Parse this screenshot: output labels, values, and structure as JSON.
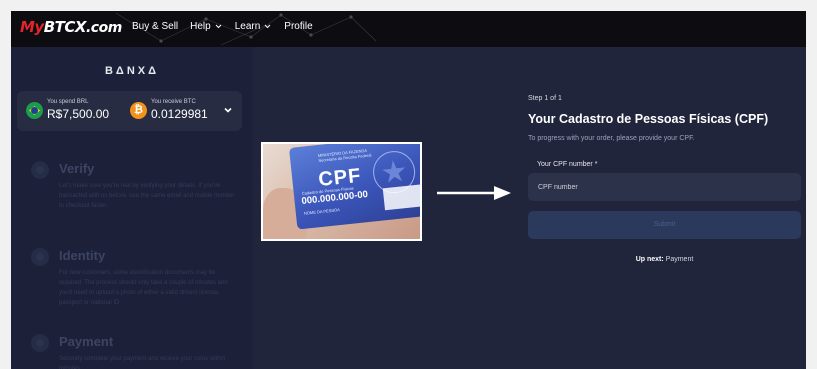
{
  "brand": {
    "my": "My",
    "btc": "BTCX",
    "dotcom": ".com"
  },
  "nav": [
    {
      "label": "Buy & Sell",
      "dropdown": false
    },
    {
      "label": "Help",
      "dropdown": true
    },
    {
      "label": "Learn",
      "dropdown": true
    },
    {
      "label": "Profile",
      "dropdown": false
    }
  ],
  "sidebar": {
    "banxa": "BΔNXΔ",
    "quote": {
      "spend_label": "You spend BRL",
      "spend_value": "R$7,500.00",
      "receive_label": "You receive BTC",
      "receive_value": "0.0129981",
      "btc_symbol": "₿"
    },
    "steps": [
      {
        "title": "Verify",
        "desc": "Let's make sure you're real by verifying your details. If you've transacted with us before, use the same email and mobile number to checkout faster."
      },
      {
        "title": "Identity",
        "desc": "For new customers, some identification documents may be required. The process should only take a couple of minutes and you'll need to upload a photo of either a valid drivers licence, passport or national ID."
      },
      {
        "title": "Payment",
        "desc": "Securely complete your payment and receive your coins within minutes."
      }
    ]
  },
  "form": {
    "step_of": "Step 1 of 1",
    "title": "Your Cadastro de Pessoas Físicas (CPF)",
    "subtitle": "To progress with your order, please provide your CPF.",
    "field_label": "Your CPF number *",
    "field_placeholder": "CPF number",
    "field_value": "",
    "submit_label": "Submit",
    "upnext_label": "Up next:",
    "upnext_value": "Payment"
  },
  "card": {
    "cpf": "CPF",
    "number": "000.000.000-00",
    "ministry": "MINISTÉRIO DA FAZENDA",
    "agency": "Secretaria da Receita Federal",
    "holder_caption": "Cadastro de Pessoas Físicas",
    "name_caption": "NOME DA PESSOA"
  },
  "colors": {
    "brand_red": "#e2242b",
    "background": "#20253b",
    "sidebar": "#1c2139",
    "topbar": "#0c0c11",
    "btc_orange": "#f2921a"
  },
  "icons": {
    "brazil_flag": "brazil-flag-icon",
    "bitcoin": "bitcoin-icon",
    "dropdown": "chevron-down-icon",
    "arrow": "arrow-right-icon"
  }
}
